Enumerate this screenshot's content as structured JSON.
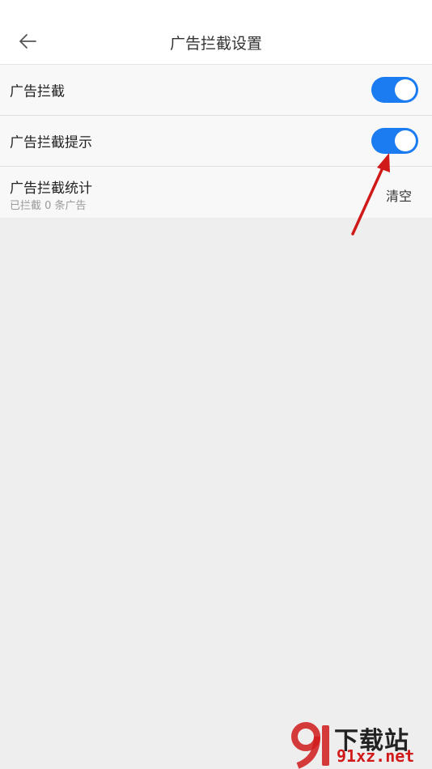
{
  "header": {
    "title": "广告拦截设置"
  },
  "settings": {
    "ad_block": {
      "label": "广告拦截",
      "enabled": true
    },
    "ad_block_tip": {
      "label": "广告拦截提示",
      "enabled": true
    },
    "ad_block_stats": {
      "label": "广告拦截统计",
      "sub": "已拦截 0 条广告",
      "action": "清空"
    }
  },
  "watermark": {
    "brand": "下载站",
    "url": "91xz.net",
    "logo": "91"
  },
  "colors": {
    "toggle_on": "#1a7cf0",
    "annotation": "#d01a1a"
  },
  "icons": {
    "back": "arrow-left-icon"
  }
}
